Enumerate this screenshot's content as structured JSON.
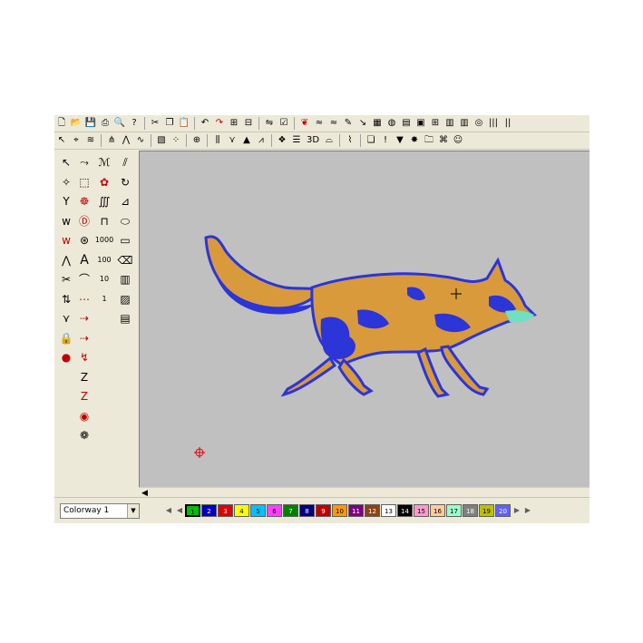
{
  "toolbar_top": {
    "icons": [
      "new-file-icon",
      "open-folder-icon",
      "save-icon",
      "print-icon",
      "print-preview-icon",
      "help-icon",
      "sep",
      "cut-icon",
      "copy-icon",
      "paste-icon",
      "sep",
      "undo-icon",
      "redo-icon",
      "group-icon",
      "ungroup-icon",
      "sep",
      "mirror-icon",
      "checkbox-icon",
      "sep",
      "red-leaf-icon",
      "stitch-icon",
      "stitch-pink-icon",
      "pencil-icon",
      "needle-icon",
      "grid-icon",
      "hoop-icon",
      "chart-icon",
      "image-icon",
      "grid-small-icon",
      "bars-icon",
      "bars-alt-icon",
      "ring-icon",
      "bars-vertical-icon",
      "bars-vertical-alt-icon"
    ]
  },
  "toolbar_second": {
    "icons": [
      "select-arrow-icon",
      "node-tool-icon",
      "stitch-tool-icon",
      "sep",
      "tack-icon",
      "zigzag-icon",
      "wave-icon",
      "sep",
      "fill-pattern-icon",
      "dots-icon",
      "sep",
      "circle-grid-icon",
      "sep",
      "column-icon",
      "fan-icon",
      "tri-icon",
      "satin-icon",
      "sep",
      "motif-icon",
      "list-icon",
      "text-3d-icon",
      "hat-icon",
      "sep",
      "brush-icon",
      "sep",
      "layers-icon",
      "exclamation-icon",
      "filter-icon",
      "star-icon",
      "folder-icon",
      "network-icon",
      "people-icon"
    ],
    "label_3d": "3D"
  },
  "left_palette": {
    "column_a": [
      "arrow-select-icon",
      "star-node-icon",
      "scissors-y-icon",
      "stitch-w-icon",
      "stitch-w-red-icon",
      "zigzag-small-icon",
      "cut-icon",
      "swap-icon",
      "fan-icon",
      "lock-icon",
      "red-stop-icon"
    ],
    "column_b": [
      "bezier-icon",
      "frame-icon",
      "swirl-icon",
      "letter-d-icon",
      "globe-icon",
      "letter-a-icon",
      "hat-shape-icon",
      "dash-icon",
      "dash-arrow-icon",
      "dash-arrow-alt-icon",
      "dash-zig-icon",
      "zig-z-icon",
      "zig-z-red-icon",
      "circle-bead-icon",
      "circle-flower-icon"
    ],
    "column_c": [
      "monogram-icon",
      "flower-icon",
      "stitch-count-icon",
      "stitch-bar-icon",
      "text-1000-icon",
      "text-100-icon",
      "text-10-icon",
      "text-1-icon"
    ],
    "column_d": [
      "diagonal-lines-icon",
      "circle-arrow-icon",
      "shape-edit-icon",
      "ellipse-icon",
      "rectangle-icon",
      "eraser-icon",
      "bars-gray-icon",
      "hatch-square-icon",
      "column-grid-icon"
    ],
    "labels": {
      "a": "A",
      "n1000": "1000",
      "n100": "100",
      "n10": "10",
      "n1": "1"
    }
  },
  "statusbar": {
    "colorway_value": "Colorway 1",
    "swatches": [
      {
        "label": "1",
        "color": "#00c000"
      },
      {
        "label": "2",
        "color": "#0000c0"
      },
      {
        "label": "3",
        "color": "#e00000"
      },
      {
        "label": "4",
        "color": "#ffff00"
      },
      {
        "label": "5",
        "color": "#00c0ff"
      },
      {
        "label": "6",
        "color": "#ff40ff"
      },
      {
        "label": "7",
        "color": "#008000"
      },
      {
        "label": "8",
        "color": "#000080"
      },
      {
        "label": "9",
        "color": "#c00000"
      },
      {
        "label": "10",
        "color": "#ff9900"
      },
      {
        "label": "11",
        "color": "#800080"
      },
      {
        "label": "12",
        "color": "#8b4513"
      },
      {
        "label": "13",
        "color": "#ffffff"
      },
      {
        "label": "14",
        "color": "#000000"
      },
      {
        "label": "15",
        "color": "#ff99cc"
      },
      {
        "label": "16",
        "color": "#ffcc99"
      },
      {
        "label": "17",
        "color": "#99ffcc"
      },
      {
        "label": "18",
        "color": "#808080"
      },
      {
        "label": "19",
        "color": "#c0c000"
      },
      {
        "label": "20",
        "color": "#6060ff"
      }
    ],
    "selected": 0
  },
  "colors": {
    "fox_orange": "#d99a3c",
    "fox_blue": "#2b35d8",
    "fox_teal": "#6fe0c0",
    "canvas": "#c0c0c0"
  }
}
